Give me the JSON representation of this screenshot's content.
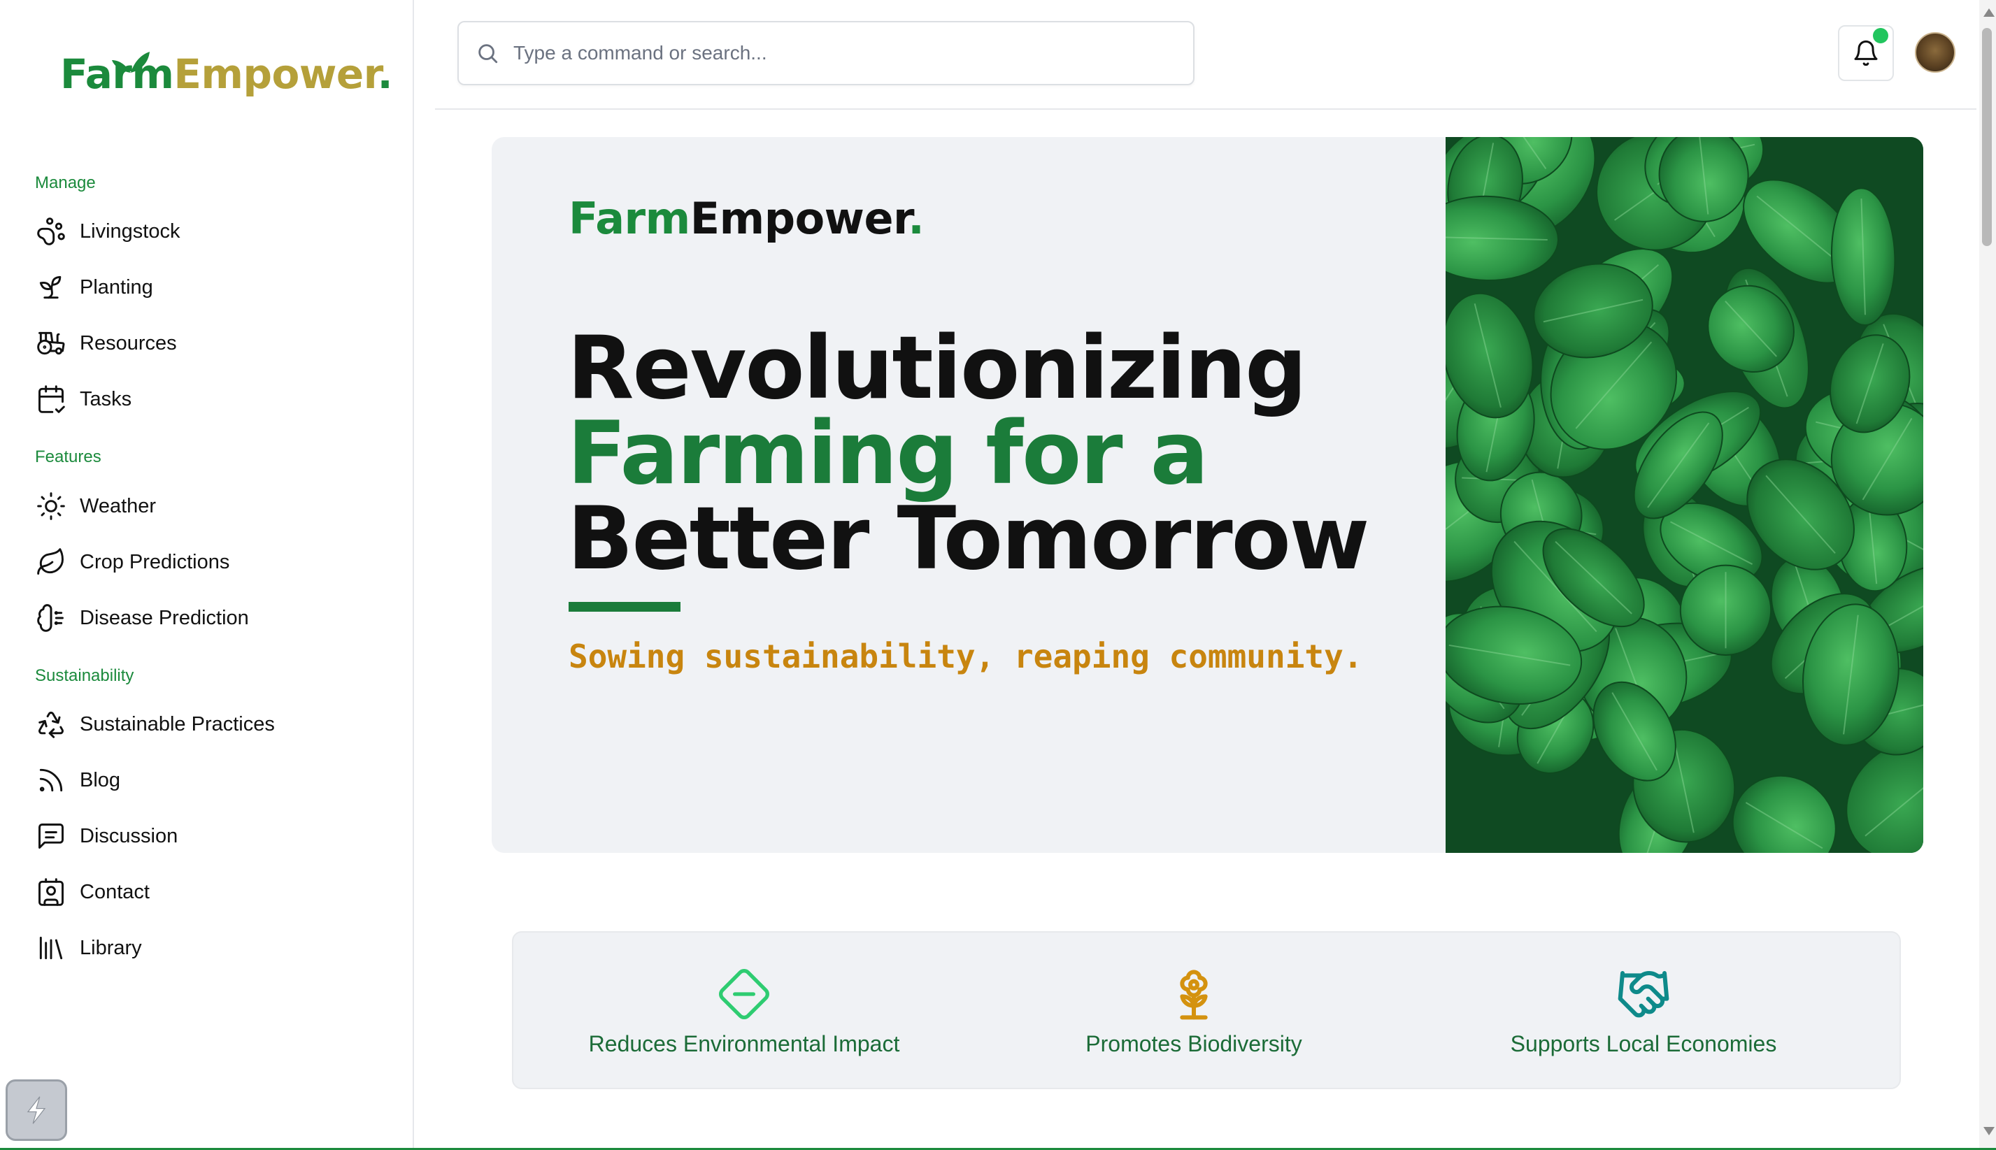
{
  "brand": {
    "farm": "Farm",
    "empower": "Empower",
    "dot": "."
  },
  "sidebar": {
    "sections": [
      {
        "label": "Manage"
      },
      {
        "label": "Features"
      },
      {
        "label": "Sustainability"
      }
    ],
    "items": [
      {
        "label": "Livingstock",
        "icon": "paw-icon"
      },
      {
        "label": "Planting",
        "icon": "sprout-icon"
      },
      {
        "label": "Resources",
        "icon": "tractor-icon"
      },
      {
        "label": "Tasks",
        "icon": "calendar-check-icon"
      },
      {
        "label": "Weather",
        "icon": "sun-icon"
      },
      {
        "label": "Crop Predictions",
        "icon": "leaf-icon"
      },
      {
        "label": "Disease Prediction",
        "icon": "microbe-icon"
      },
      {
        "label": "Sustainable Practices",
        "icon": "recycle-icon"
      },
      {
        "label": "Blog",
        "icon": "rss-icon"
      },
      {
        "label": "Discussion",
        "icon": "message-icon"
      },
      {
        "label": "Contact",
        "icon": "contact-icon"
      },
      {
        "label": "Library",
        "icon": "library-icon"
      }
    ]
  },
  "search": {
    "placeholder": "Type a command or search..."
  },
  "hero": {
    "line1": "Revolutionizing",
    "line2": "Farming for a",
    "line3": "Better Tomorrow",
    "tagline": "Sowing sustainability, reaping community."
  },
  "features": [
    {
      "label": "Reduces Environmental Impact",
      "icon": "diamond-minus-icon",
      "color": "#2ecc71"
    },
    {
      "label": "Promotes Biodiversity",
      "icon": "flower-icon",
      "color": "#d4920f"
    },
    {
      "label": "Supports Local Economies",
      "icon": "handshake-icon",
      "color": "#0e8a8a"
    }
  ],
  "colors": {
    "brand_green": "#1b8a3c",
    "brand_gold": "#b5a03a",
    "tagline": "#c8850f",
    "notification": "#22c55e"
  }
}
